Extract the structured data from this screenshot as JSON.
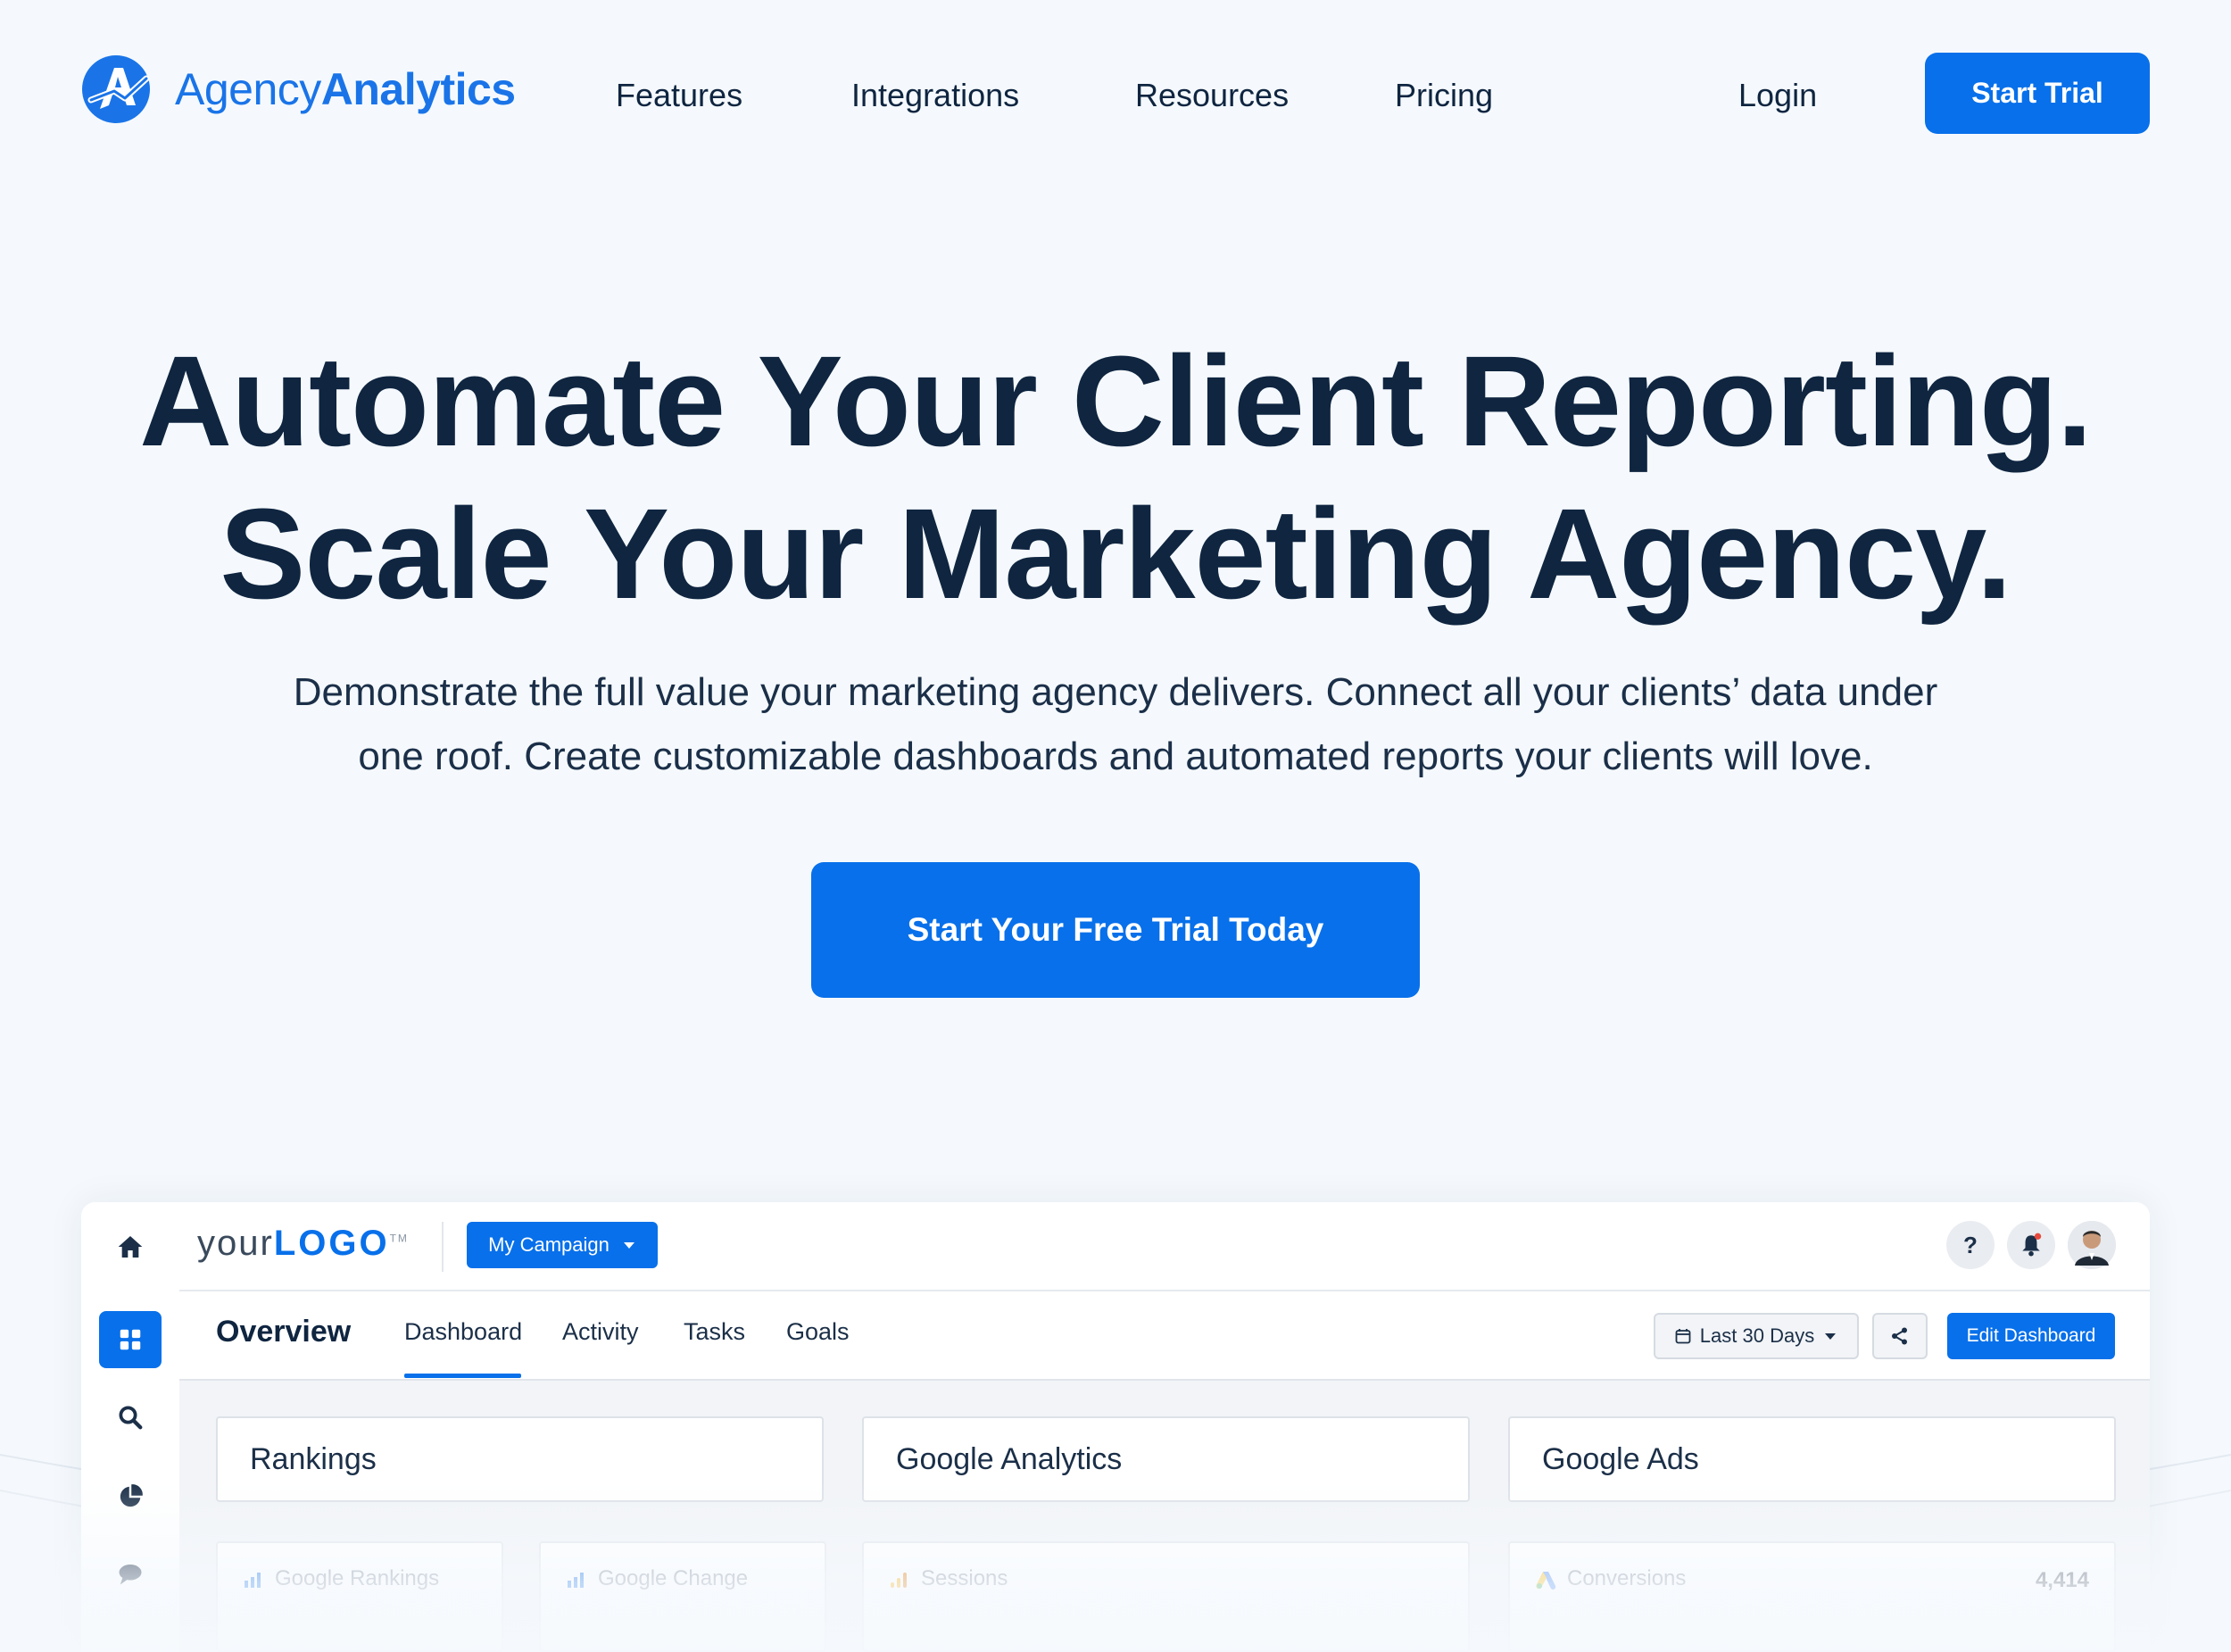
{
  "brand": {
    "name_light": "Agency",
    "name_bold": "Analytics",
    "accent_color": "#0870ea",
    "text_color": "#0f2540"
  },
  "nav": {
    "items": [
      "Features",
      "Integrations",
      "Resources",
      "Pricing"
    ],
    "login": "Login",
    "cta": "Start Trial"
  },
  "hero": {
    "title_line1": "Automate Your Client Reporting.",
    "title_line2": "Scale Your Marketing Agency.",
    "subtitle_line1": "Demonstrate the full value your marketing agency delivers. Connect all your clients’ data under",
    "subtitle_line2": "one roof. Create customizable dashboards and automated reports your clients will love.",
    "cta": "Start Your Free Trial Today"
  },
  "dashboard": {
    "logo_light": "your",
    "logo_bold": "LOGO",
    "logo_tm": "TM",
    "campaign_select": "My Campaign",
    "page_title": "Overview",
    "tabs": [
      "Dashboard",
      "Activity",
      "Tasks",
      "Goals"
    ],
    "active_tab": "Dashboard",
    "date_range": "Last 30 Days",
    "edit_button": "Edit Dashboard",
    "sidebar_icons": [
      "home-icon",
      "grid-icon",
      "search-icon",
      "pie-chart-icon",
      "chat-icon"
    ],
    "topbar_icons": [
      "help-icon",
      "bell-icon",
      "avatar"
    ],
    "sections": [
      "Rankings",
      "Google Analytics",
      "Google Ads"
    ],
    "widgets": [
      {
        "label": "Google Rankings",
        "value": ""
      },
      {
        "label": "Google Change",
        "value": ""
      },
      {
        "label": "Sessions",
        "value": ""
      },
      {
        "label": "Conversions",
        "value": "4,414"
      }
    ]
  }
}
